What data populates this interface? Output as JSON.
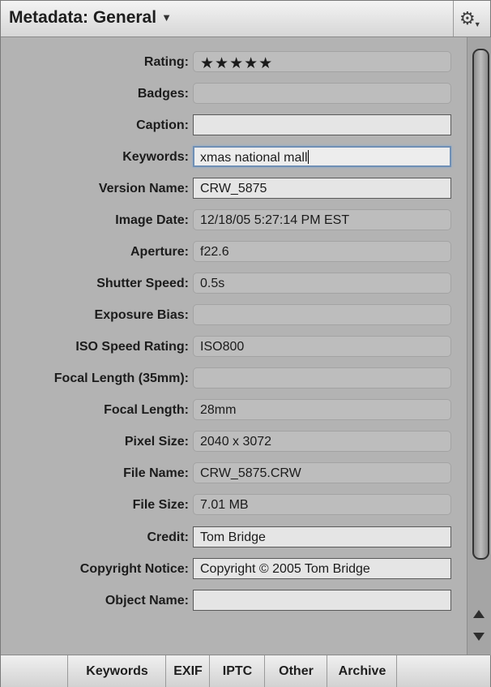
{
  "header": {
    "title": "Metadata: General",
    "dropdown_icon": "caret-down",
    "action_icon": "gear"
  },
  "fields": [
    {
      "label": "Rating:",
      "value": "★★★★★",
      "style": "readonly",
      "kind": "rating"
    },
    {
      "label": "Badges:",
      "value": "",
      "style": "readonly"
    },
    {
      "label": "Caption:",
      "value": "",
      "style": "editable"
    },
    {
      "label": "Keywords:",
      "value": "xmas national mall",
      "style": "focused"
    },
    {
      "label": "Version Name:",
      "value": "CRW_5875",
      "style": "editable"
    },
    {
      "label": "Image Date:",
      "value": "12/18/05 5:27:14 PM EST",
      "style": "readonly"
    },
    {
      "label": "Aperture:",
      "value": "f22.6",
      "style": "readonly"
    },
    {
      "label": "Shutter Speed:",
      "value": "0.5s",
      "style": "readonly"
    },
    {
      "label": "Exposure Bias:",
      "value": "",
      "style": "readonly"
    },
    {
      "label": "ISO Speed Rating:",
      "value": "ISO800",
      "style": "readonly"
    },
    {
      "label": "Focal Length (35mm):",
      "value": "",
      "style": "readonly"
    },
    {
      "label": "Focal Length:",
      "value": "28mm",
      "style": "readonly"
    },
    {
      "label": "Pixel Size:",
      "value": "2040 x 3072",
      "style": "readonly"
    },
    {
      "label": "File Name:",
      "value": "CRW_5875.CRW",
      "style": "readonly"
    },
    {
      "label": "File Size:",
      "value": "7.01 MB",
      "style": "readonly"
    },
    {
      "label": "Credit:",
      "value": "Tom Bridge",
      "style": "editable"
    },
    {
      "label": "Copyright Notice:",
      "value": "Copyright © 2005 Tom Bridge",
      "style": "editable"
    },
    {
      "label": "Object Name:",
      "value": "",
      "style": "editable"
    }
  ],
  "tabs": [
    "Keywords",
    "EXIF",
    "IPTC",
    "Other",
    "Archive"
  ],
  "colors": {
    "panel_bg": "#b3b3b3",
    "focus_ring": "#6f8fb5"
  }
}
